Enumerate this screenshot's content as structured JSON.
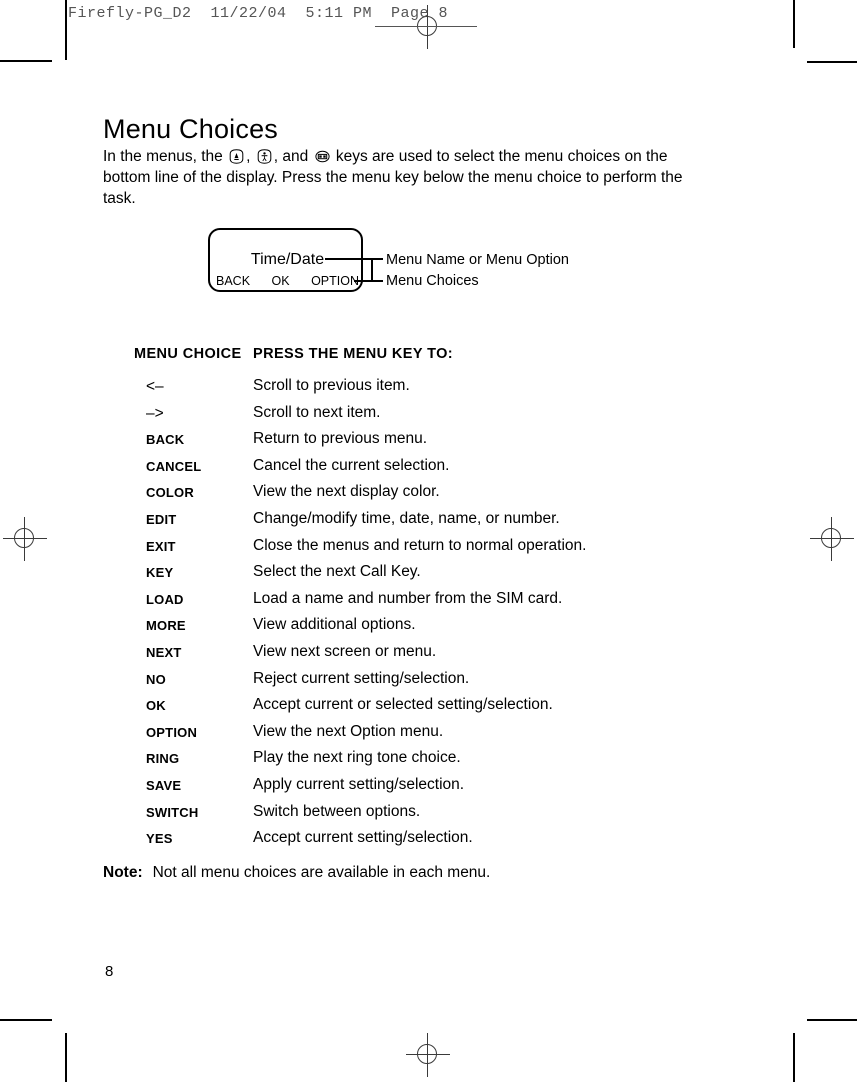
{
  "film_slug": {
    "text": "Firefly-PG_D2  11/22/04  5:11 PM  Page 8"
  },
  "page": {
    "title": "Menu Choices",
    "intro_part1": "In the menus, the",
    "intro_part2": ",",
    "intro_part3": ", and",
    "intro_part4": "keys are used to select the menu choices on the bottom line of the display. Press the menu key below the menu choice to perform the task.",
    "folio": "8"
  },
  "icons": {
    "up_key": "up-arrow-key-icon",
    "person_key": "person-key-icon",
    "menu_key": "menu-display-key-icon"
  },
  "diagram": {
    "display_title": "Time/Date",
    "soft_keys": [
      "BACK",
      "OK",
      "OPTION"
    ],
    "callout_top": "Menu Name or Menu Option",
    "callout_bottom": "Menu Choices"
  },
  "table": {
    "header_choice": "MENU CHOICE",
    "header_action": "PRESS THE MENU KEY TO:",
    "rows": [
      {
        "choice": "<–",
        "style": "plain",
        "desc": "Scroll to previous item."
      },
      {
        "choice": "–>",
        "style": "plain",
        "desc": "Scroll to next item."
      },
      {
        "choice": "BACK",
        "style": "bold",
        "desc": "Return to previous menu."
      },
      {
        "choice": "CANCEL",
        "style": "bold",
        "desc": "Cancel the current selection."
      },
      {
        "choice": "COLOR",
        "style": "bold",
        "desc": "View the next display color."
      },
      {
        "choice": "EDIT",
        "style": "bold",
        "desc": "Change/modify time, date, name, or number."
      },
      {
        "choice": "EXIT",
        "style": "bold",
        "desc": "Close the menus and return to normal operation."
      },
      {
        "choice": "KEY",
        "style": "bold",
        "desc": "Select the next Call Key."
      },
      {
        "choice": "LOAD",
        "style": "bold",
        "desc": "Load a name and number from the SIM card."
      },
      {
        "choice": "MORE",
        "style": "bold",
        "desc": "View additional options."
      },
      {
        "choice": "NEXT",
        "style": "bold",
        "desc": "View next screen or menu."
      },
      {
        "choice": "NO",
        "style": "bold",
        "desc": "Reject current setting/selection."
      },
      {
        "choice": "OK",
        "style": "bold",
        "desc": "Accept current or selected setting/selection."
      },
      {
        "choice": "OPTION",
        "style": "bold",
        "desc": "View the next Option menu."
      },
      {
        "choice": "RING",
        "style": "bold",
        "desc": "Play the next ring tone choice."
      },
      {
        "choice": "SAVE",
        "style": "bold",
        "desc": "Apply current setting/selection."
      },
      {
        "choice": "SWITCH",
        "style": "bold",
        "desc": "Switch between options."
      },
      {
        "choice": "YES",
        "style": "bold",
        "desc": "Accept current setting/selection."
      }
    ]
  },
  "note": {
    "label": "Note:",
    "text": "Not all menu choices are available in each menu."
  },
  "colors": {
    "ink": "#000000",
    "slug": "#555555",
    "registration": "#3a3a3a"
  }
}
